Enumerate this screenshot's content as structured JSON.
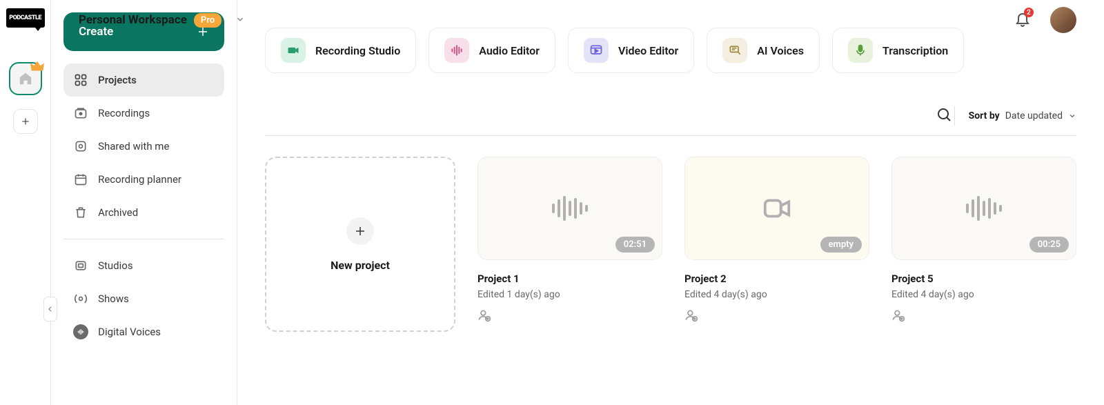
{
  "header": {
    "workspace_title": "Personal Workspace",
    "badge": "Pro",
    "notification_count": "2"
  },
  "sidebar": {
    "create_label": "Create",
    "nav": [
      {
        "label": "Projects",
        "icon": "grid-icon",
        "active": true
      },
      {
        "label": "Recordings",
        "icon": "video-record-icon"
      },
      {
        "label": "Shared with me",
        "icon": "share-icon"
      },
      {
        "label": "Recording planner",
        "icon": "calendar-icon"
      },
      {
        "label": "Archived",
        "icon": "trash-icon"
      }
    ],
    "nav2": [
      {
        "label": "Studios",
        "icon": "studio-icon"
      },
      {
        "label": "Shows",
        "icon": "broadcast-icon"
      },
      {
        "label": "Digital Voices",
        "icon": "voice-icon"
      }
    ]
  },
  "tools": [
    {
      "label": "Recording Studio",
      "color": "ci-green"
    },
    {
      "label": "Audio Editor",
      "color": "ci-pink"
    },
    {
      "label": "Video Editor",
      "color": "ci-purple"
    },
    {
      "label": "AI Voices",
      "color": "ci-yellow"
    },
    {
      "label": "Transcription",
      "color": "ci-lime"
    }
  ],
  "sort": {
    "label": "Sort by",
    "value": "Date updated"
  },
  "new_project_label": "New project",
  "projects": [
    {
      "title": "Project 1",
      "meta": "Edited 1 day(s) ago",
      "duration": "02:51",
      "type": "audio"
    },
    {
      "title": "Project 2",
      "meta": "Edited 4 day(s) ago",
      "duration": "empty",
      "type": "video"
    },
    {
      "title": "Project 5",
      "meta": "Edited 4 day(s) ago",
      "duration": "00:25",
      "type": "audio"
    }
  ]
}
